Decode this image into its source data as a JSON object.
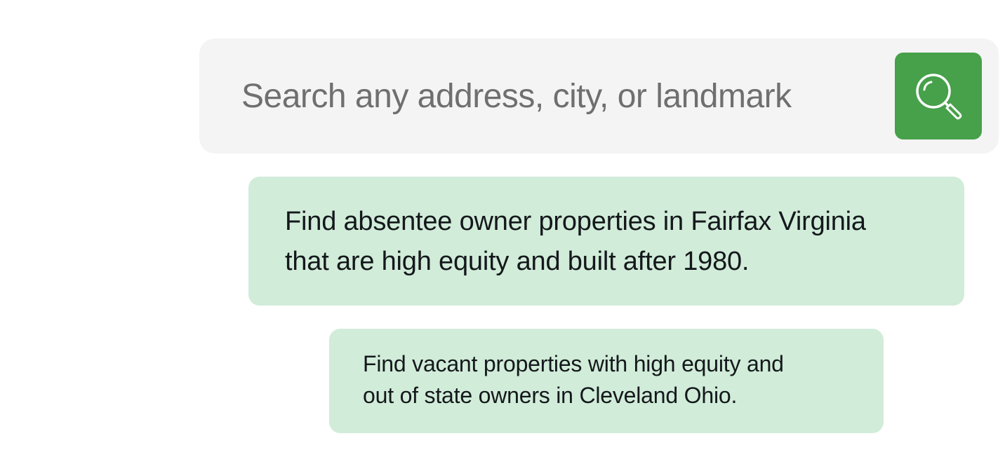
{
  "search": {
    "placeholder": "Search any address, city, or landmark",
    "button_icon": "search-icon",
    "button_color": "#47a04a",
    "bar_color": "#f4f4f4"
  },
  "suggestions": [
    {
      "lines": [
        "Find absentee owner properties in Fairfax Virginia",
        "that are high equity and built after 1980."
      ]
    },
    {
      "lines": [
        "Find vacant properties with high equity and",
        "out of state owners in Cleveland Ohio."
      ]
    }
  ],
  "colors": {
    "suggestion_bg": "#d1ecd9",
    "suggestion_text": "#14181c",
    "placeholder_text": "#6f6f6f"
  }
}
